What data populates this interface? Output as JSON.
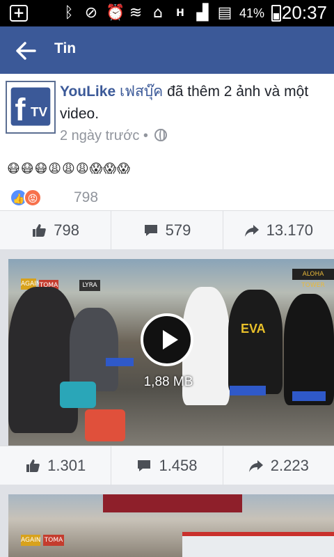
{
  "status_bar": {
    "battery_percent": "41%",
    "time": "20:37",
    "icons": [
      "plus-icon",
      "bluetooth-icon",
      "mute-icon",
      "alarm-icon",
      "wifi-icon",
      "home-icon",
      "signal-h-icon",
      "signal-icon",
      "sim-icon",
      "battery-icon"
    ],
    "h_label": "H"
  },
  "app_bar": {
    "title": "Tin",
    "back_icon": "back-arrow-icon",
    "color": "#3b5998"
  },
  "post": {
    "page_name": "YouLike",
    "page_name_thai": "เฟสบุ๊ค",
    "action_text": "đã thêm 2 ảnh và một video.",
    "time": "2 ngày trước •",
    "emojis": "😷😷😷😩😩😩😱😱😱",
    "reaction_count": "798",
    "likes": "798",
    "comments": "579",
    "shares": "13.170"
  },
  "video": {
    "size": "1,88 MB",
    "signs": [
      "AGAIN",
      "TOMA",
      "LYRA",
      "EVA",
      "ALOHA TOWER"
    ],
    "likes": "1.301",
    "comments": "1.458",
    "shares": "2.223"
  },
  "video2": {
    "signs": [
      "AGAIN",
      "TOMA"
    ]
  }
}
